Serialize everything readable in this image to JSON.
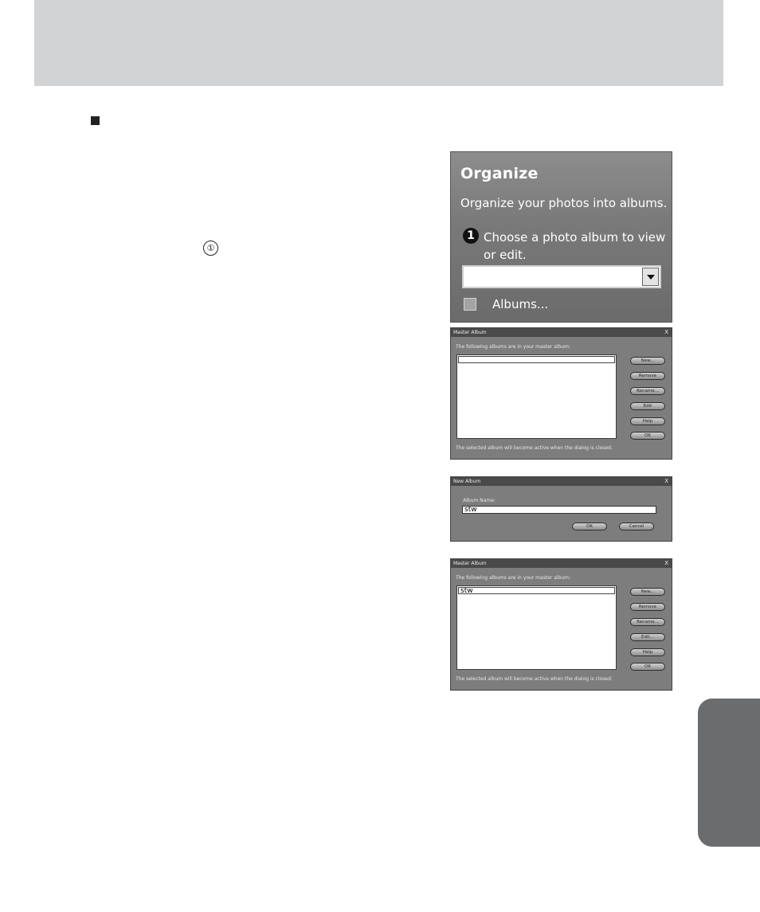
{
  "marker": "①",
  "organize": {
    "title": "Organize",
    "subtitle": "Organize your photos into albums.",
    "step_number": "1",
    "step_text": "Choose a photo album to view or edit.",
    "albums_label": "Albums..."
  },
  "master_album_empty": {
    "title": "Master Album",
    "close": "X",
    "caption": "The following albums are in your master album:",
    "items": [
      ""
    ],
    "buttons": [
      "New...",
      "Remove",
      "Rename...",
      "Edit",
      "Help",
      "OK"
    ],
    "footer": "The selected album will become active when the dialog is closed."
  },
  "new_album": {
    "title": "New Album",
    "close": "X",
    "field_label": "Album Name:",
    "field_value": "stw",
    "ok_label": "OK",
    "cancel_label": "Cancel"
  },
  "master_album_filled": {
    "title": "Master Album",
    "close": "X",
    "caption": "The following albums are in your master album:",
    "items": [
      "stw"
    ],
    "buttons": [
      "New...",
      "Remove",
      "Rename...",
      "Edit...",
      "Help",
      "OK"
    ],
    "footer": "The selected album will become active when the dialog is closed."
  }
}
